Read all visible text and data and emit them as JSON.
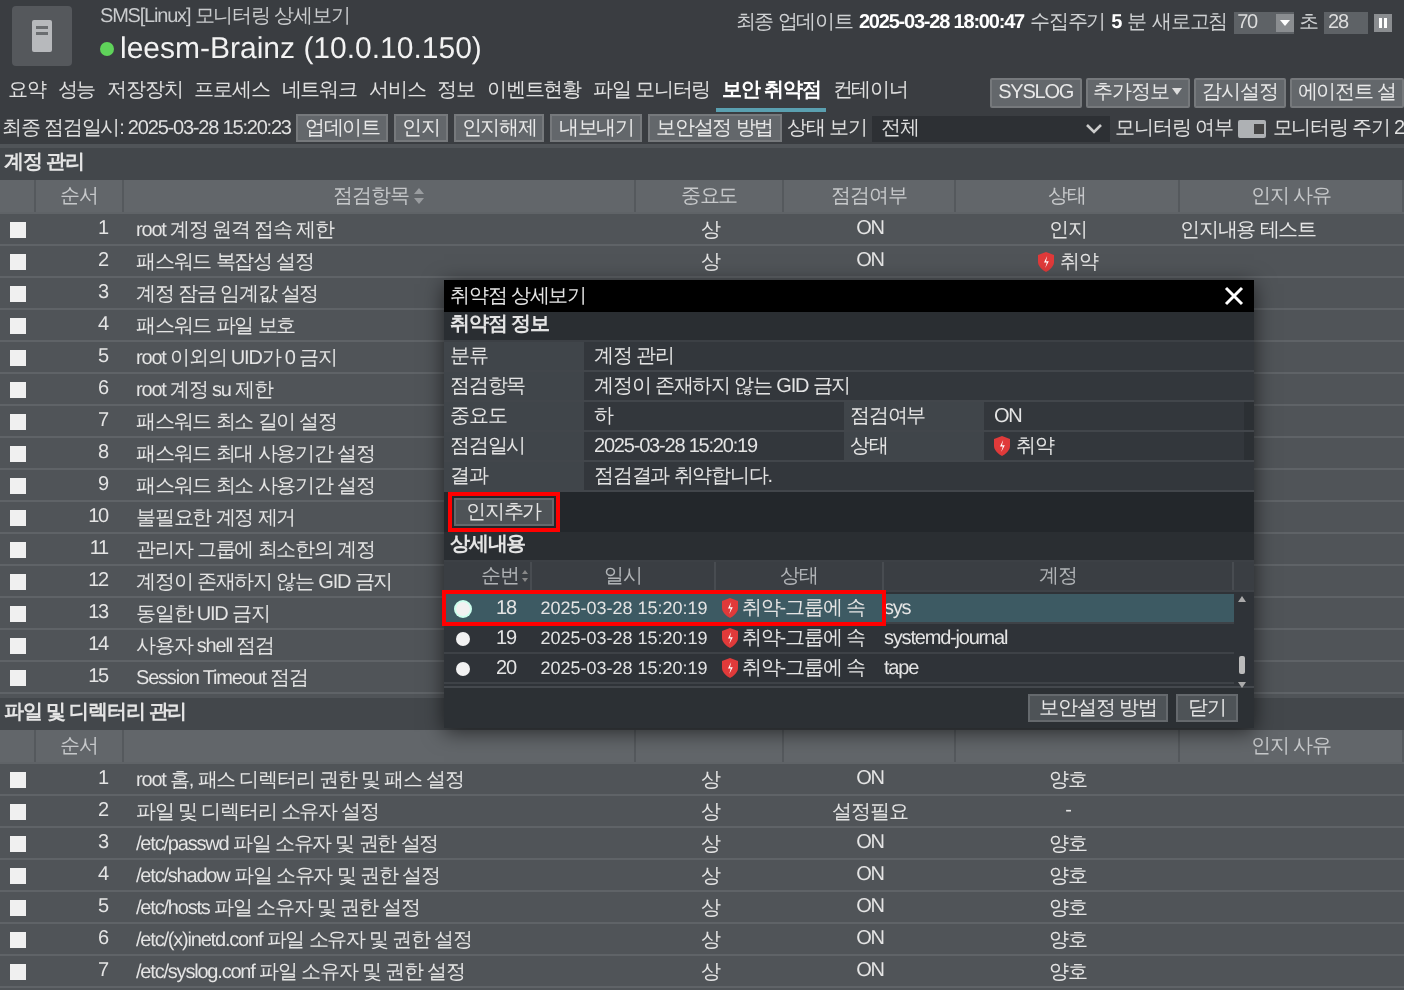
{
  "header": {
    "subtitle": "SMS[Linux] 모니터링 상세보기",
    "host": "leesm-Brainz (10.0.10.150)",
    "online": true,
    "update_label": "최종 업데이트",
    "update_time": "2025-03-28 18:00:47",
    "interval_label": "수집주기",
    "interval_value": "5",
    "interval_unit": "분",
    "refresh_label": "새로고침",
    "refresh_value": "70",
    "seconds_label": "초",
    "countdown": "28"
  },
  "tabs": [
    {
      "label": "요약",
      "selected": false
    },
    {
      "label": "성능",
      "selected": false
    },
    {
      "label": "저장장치",
      "selected": false
    },
    {
      "label": "프로세스",
      "selected": false
    },
    {
      "label": "네트워크",
      "selected": false
    },
    {
      "label": "서비스",
      "selected": false
    },
    {
      "label": "정보",
      "selected": false
    },
    {
      "label": "이벤트현황",
      "selected": false
    },
    {
      "label": "파일 모니터링",
      "selected": false
    },
    {
      "label": "보안 취약점",
      "selected": true
    },
    {
      "label": "컨테이너",
      "selected": false
    }
  ],
  "actions": [
    {
      "label": "SYSLOG",
      "dropdown": false
    },
    {
      "label": "추가정보",
      "dropdown": true
    },
    {
      "label": "감시설정",
      "dropdown": false
    },
    {
      "label": "에이전트 설",
      "dropdown": false
    }
  ],
  "toolbar": {
    "last_check": "최종 점검일시: 2025-03-28 15:20:23",
    "buttons": [
      "업데이트",
      "인지",
      "인지해제",
      "내보내기",
      "보안설정 방법"
    ],
    "filter_label": "상태 보기",
    "filter_value": "전체",
    "monitoring_label": "모니터링 여부",
    "monitoring_on": true,
    "period_label": "모니터링 주기 2"
  },
  "sections": [
    {
      "title": "계정 관리",
      "columns": [
        {
          "label": "순서",
          "sorted": false
        },
        {
          "label": "점검항목",
          "sorted": true
        },
        {
          "label": "중요도",
          "sorted": false
        },
        {
          "label": "점검여부",
          "sorted": false
        },
        {
          "label": "상태",
          "sorted": false
        },
        {
          "label": "인지 사유",
          "sorted": false
        }
      ],
      "rows": [
        {
          "checked": false,
          "no": "1",
          "item": "root 계정 원격 접속 제한",
          "severity": "상",
          "enabled": "ON",
          "status": {
            "kind": "plain",
            "text": "인지"
          },
          "reason": "인지내용 테스트"
        },
        {
          "checked": false,
          "no": "2",
          "item": "패스워드 복잡성 설정",
          "severity": "상",
          "enabled": "ON",
          "status": {
            "kind": "vulnerable",
            "text": "취약"
          }
        },
        {
          "checked": false,
          "no": "3",
          "item": "계정 잠금 임계값 설정"
        },
        {
          "checked": false,
          "no": "4",
          "item": "패스워드 파일 보호"
        },
        {
          "checked": false,
          "no": "5",
          "item": "root 이외의 UID가 0 금지"
        },
        {
          "checked": false,
          "no": "6",
          "item": "root 계정 su 제한"
        },
        {
          "checked": false,
          "no": "7",
          "item": "패스워드 최소 길이 설정"
        },
        {
          "checked": false,
          "no": "8",
          "item": "패스워드 최대 사용기간 설정"
        },
        {
          "checked": false,
          "no": "9",
          "item": "패스워드 최소 사용기간 설정"
        },
        {
          "checked": false,
          "no": "10",
          "item": "불필요한 계정 제거"
        },
        {
          "checked": false,
          "no": "11",
          "item": "관리자 그룹에 최소한의 계정"
        },
        {
          "checked": false,
          "no": "12",
          "item": "계정이 존재하지 않는 GID 금지"
        },
        {
          "checked": false,
          "no": "13",
          "item": "동일한 UID 금지"
        },
        {
          "checked": false,
          "no": "14",
          "item": "사용자 shell 점검"
        },
        {
          "checked": false,
          "no": "15",
          "item": "Session Timeout 점검"
        }
      ]
    },
    {
      "title": "파일 및 디렉터리 관리",
      "columns": [
        {
          "label": "순서",
          "sorted": false
        },
        {
          "label": "인지 사유",
          "sorted": false
        }
      ],
      "rows": [
        {
          "checked": false,
          "no": "1",
          "item": "root 홈, 패스 디렉터리 권한 및 패스 설정",
          "severity": "상",
          "enabled": "ON",
          "status": {
            "kind": "plain",
            "text": "양호"
          }
        },
        {
          "checked": false,
          "no": "2",
          "item": "파일 및 디렉터리 소유자 설정",
          "severity": "상",
          "enabled": "설정필요",
          "status": {
            "kind": "plain",
            "text": "-"
          }
        },
        {
          "checked": false,
          "no": "3",
          "item": "/etc/passwd 파일 소유자 및 권한 설정",
          "severity": "상",
          "enabled": "ON",
          "status": {
            "kind": "plain",
            "text": "양호"
          }
        },
        {
          "checked": false,
          "no": "4",
          "item": "/etc/shadow 파일 소유자 및 권한 설정",
          "severity": "상",
          "enabled": "ON",
          "status": {
            "kind": "plain",
            "text": "양호"
          }
        },
        {
          "checked": false,
          "no": "5",
          "item": "/etc/hosts 파일 소유자 및 권한 설정",
          "severity": "상",
          "enabled": "ON",
          "status": {
            "kind": "plain",
            "text": "양호"
          }
        },
        {
          "checked": false,
          "no": "6",
          "item": "/etc/(x)inetd.conf 파일 소유자 및 권한 설정",
          "severity": "상",
          "enabled": "ON",
          "status": {
            "kind": "plain",
            "text": "양호"
          }
        },
        {
          "checked": false,
          "no": "7",
          "item": "/etc/syslog.conf 파일 소유자 및 권한 설정",
          "severity": "상",
          "enabled": "ON",
          "status": {
            "kind": "plain",
            "text": "양호"
          }
        }
      ]
    }
  ],
  "modal": {
    "title": "취약점 상세보기",
    "info_title": "취약점 정보",
    "info": [
      [
        {
          "label": "분류",
          "value": "계정 관리",
          "kind": "plain"
        }
      ],
      [
        {
          "label": "점검항목",
          "value": "계정이 존재하지 않는 GID 금지",
          "kind": "plain"
        }
      ],
      [
        {
          "label": "중요도",
          "value": "하",
          "kind": "plain"
        },
        {
          "label": "점검여부",
          "value": "ON",
          "kind": "plain"
        }
      ],
      [
        {
          "label": "점검일시",
          "value": "2025-03-28 15:20:19",
          "kind": "plain"
        },
        {
          "label": "상태",
          "value": "취약",
          "kind": "vulnerable"
        }
      ],
      [
        {
          "label": "결과",
          "value": "점검결과 취약합니다.",
          "kind": "plain"
        }
      ]
    ],
    "ack_button": {
      "label": "인지추가",
      "highlighted": true
    },
    "detail_title": "상세내용",
    "detail_columns": [
      {
        "label": "순번",
        "sorted": true
      },
      {
        "label": "일시",
        "sorted": false
      },
      {
        "label": "상태",
        "sorted": false
      },
      {
        "label": "계정",
        "sorted": false
      }
    ],
    "detail_rows": [
      {
        "selected": true,
        "highlighted": true,
        "no": "18",
        "time": "2025-03-28 15:20:19",
        "status": {
          "kind": "vulnerable",
          "text": "취약-그룹에 속"
        },
        "account": "sys"
      },
      {
        "selected": false,
        "highlighted": false,
        "no": "19",
        "time": "2025-03-28 15:20:19",
        "status": {
          "kind": "vulnerable",
          "text": "취약-그룹에 속"
        },
        "account": "systemd-journal"
      },
      {
        "selected": false,
        "highlighted": false,
        "no": "20",
        "time": "2025-03-28 15:20:19",
        "status": {
          "kind": "vulnerable",
          "text": "취약-그룹에 속"
        },
        "account": "tape"
      }
    ],
    "buttons": [
      "보안설정 방법",
      "닫기"
    ]
  }
}
